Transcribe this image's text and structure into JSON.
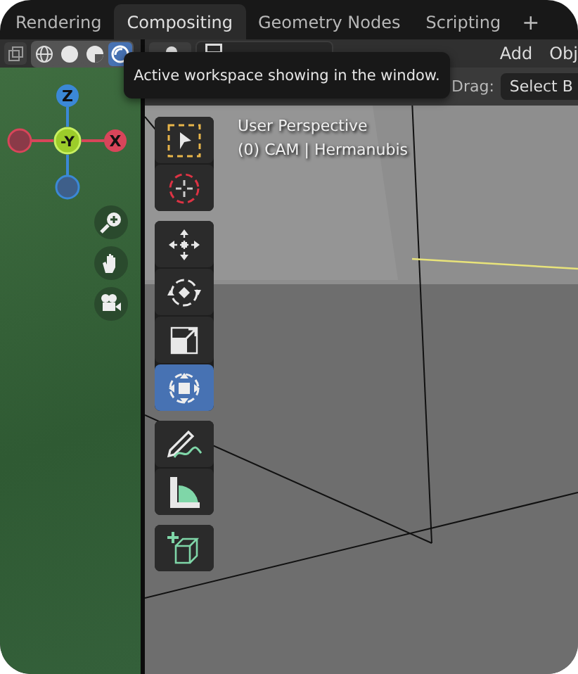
{
  "workspace_tabs": [
    {
      "label": "Rendering",
      "selected": false
    },
    {
      "label": "Compositing",
      "selected": true
    },
    {
      "label": "Geometry Nodes",
      "selected": false
    },
    {
      "label": "Scripting",
      "selected": false
    }
  ],
  "add_tab": "+",
  "shading_modes": [
    {
      "kind": "wireframe",
      "selected": false
    },
    {
      "kind": "solid",
      "selected": false
    },
    {
      "kind": "material",
      "selected": false
    },
    {
      "kind": "rendered",
      "selected": true
    }
  ],
  "header": {
    "menus": [
      "Add",
      "Obj"
    ]
  },
  "tooltip": "Active workspace showing in the window.",
  "tool_settings": {
    "drag_label": "Drag:",
    "drag_value": "Select B"
  },
  "viewport": {
    "title": "User Perspective",
    "object": "(0) CAM | Hermanubis"
  },
  "gizmo": {
    "z": "Z",
    "x": "X",
    "neg_y": "-Y"
  },
  "toolbar": [
    [
      {
        "kind": "select_box",
        "selected": false
      },
      {
        "kind": "cursor",
        "selected": false
      }
    ],
    [
      {
        "kind": "move",
        "selected": false
      },
      {
        "kind": "rotate",
        "selected": false
      },
      {
        "kind": "scale",
        "selected": false
      },
      {
        "kind": "transform",
        "selected": true
      }
    ],
    [
      {
        "kind": "annotate",
        "selected": false
      },
      {
        "kind": "measure",
        "selected": false
      }
    ],
    [
      {
        "kind": "add_cube",
        "selected": false
      }
    ]
  ]
}
